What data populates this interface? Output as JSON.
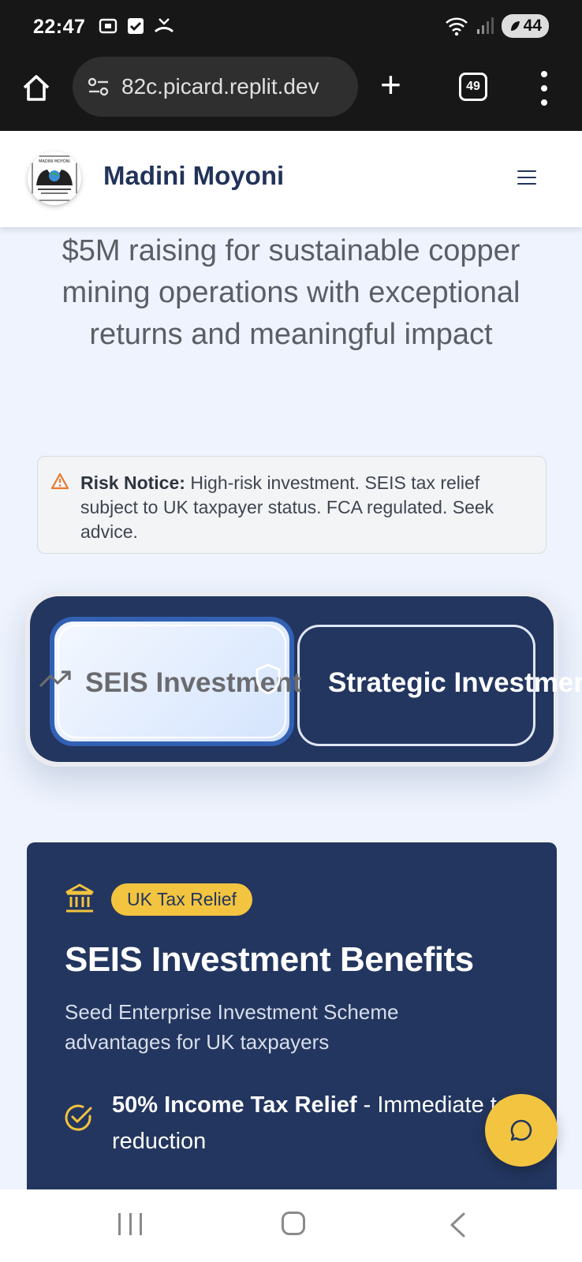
{
  "status_bar": {
    "time": "22:47",
    "battery": "44",
    "icons": [
      "screenshot-icon",
      "checkbox-icon",
      "missed-call-icon",
      "wifi-icon",
      "signal-icon",
      "battery-icon"
    ]
  },
  "browser": {
    "url": "82c.picard.replit.dev",
    "tab_count": "49"
  },
  "header": {
    "brand": "Madini Moyoni",
    "logo_text": "MADINI MOYONI"
  },
  "hero": {
    "subtitle": "$5M raising for sustainable copper mining operations with exceptional returns and meaningful impact"
  },
  "risk_notice": {
    "label": "Risk Notice:",
    "text": " High-risk investment. SEIS tax relief subject to UK taxpayer status. FCA regulated. Seek advice."
  },
  "toggle": {
    "option_seis": "SEIS Investment",
    "option_strategic": "Strategic Investment",
    "selected": "SEIS Investment"
  },
  "benefits": {
    "badge": "UK Tax Relief",
    "title": "SEIS Investment Benefits",
    "subtitle": "Seed Enterprise Investment Scheme advantages for UK taxpayers",
    "items": [
      {
        "bold": "50% Income Tax Relief",
        "rest": " - Immediate tax reduction"
      }
    ]
  },
  "colors": {
    "navy": "#23365f",
    "gold": "#f3c43f",
    "accent_blue": "#3261b4",
    "page_bg": "#eef3fd"
  }
}
